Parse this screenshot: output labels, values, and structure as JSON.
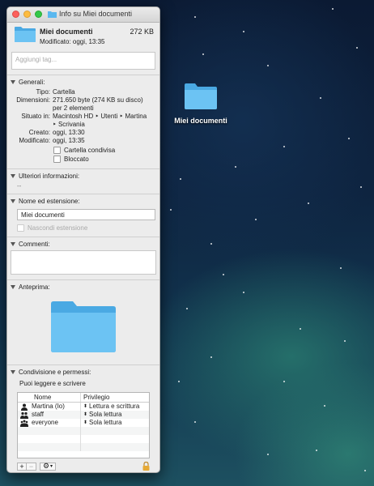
{
  "window": {
    "title": "Info su Miei documenti",
    "name": "Miei documenti",
    "size": "272 KB",
    "modified_line": "Modificato:  oggi, 13:35",
    "tags_placeholder": "Aggiungi tag..."
  },
  "general": {
    "label": "Generali:",
    "rows": [
      {
        "k": "Tipo:",
        "v": "Cartella"
      },
      {
        "k": "Dimensioni:",
        "v": "271.650 byte (274 KB su disco)"
      },
      {
        "k": "",
        "v": "per 2 elementi"
      },
      {
        "k": "Situato in:",
        "v": "Macintosh HD ‣ Utenti ‣ Martina"
      },
      {
        "k": "",
        "v": "‣ Scrivania"
      },
      {
        "k": "Creato:",
        "v": "oggi, 13:30"
      },
      {
        "k": "Modificato:",
        "v": "oggi, 13:35"
      }
    ],
    "shared_label": "Cartella condivisa",
    "locked_label": "Bloccato"
  },
  "more_info": {
    "label": "Ulteriori informazioni:",
    "value": "--"
  },
  "name_ext": {
    "label": "Nome ed estensione:",
    "value": "Miei documenti",
    "hide_ext_label": "Nascondi estensione"
  },
  "comments": {
    "label": "Commenti:"
  },
  "preview": {
    "label": "Anteprima:"
  },
  "sharing": {
    "label": "Condivisione e permessi:",
    "summary": "Puoi leggere e scrivere",
    "col_name": "Nome",
    "col_priv": "Privilegio",
    "rows": [
      {
        "name": "Martina (Io)",
        "priv": "Lettura e scrittura",
        "icon": "user-icon"
      },
      {
        "name": "staff",
        "priv": "Sola lettura",
        "icon": "group-icon"
      },
      {
        "name": "everyone",
        "priv": "Sola lettura",
        "icon": "everyone-icon"
      }
    ],
    "add": "+",
    "remove": "−",
    "gear": "⚙︎"
  },
  "desktop": {
    "icon_label": "Miei documenti"
  },
  "colors": {
    "folder": "#5ab8ef",
    "accent": "#3b99fc"
  }
}
